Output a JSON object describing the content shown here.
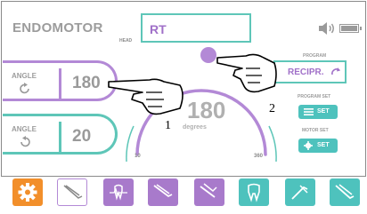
{
  "header": {
    "app_title": "ENDOMOTOR",
    "head_label": "HEAD",
    "head_value": "RT"
  },
  "angles": {
    "forward": {
      "label": "ANGLE",
      "value": "180"
    },
    "reverse": {
      "label": "ANGLE",
      "value": "20"
    }
  },
  "dial": {
    "value": "180",
    "unit": "degrees",
    "min": "10",
    "max": "360"
  },
  "program": {
    "label": "PROGRAM",
    "value": "RECIPR.",
    "program_set_label": "PROGRAM SET",
    "motor_set_label": "MOTOR SET",
    "set_label": "SET"
  },
  "callouts": {
    "one": "1",
    "two": "2"
  },
  "toolbar": {
    "items": [
      {
        "name": "settings",
        "icon": "gear-icon",
        "color": "#f28f2b"
      },
      {
        "name": "tool-1",
        "icon": "handpiece-icon",
        "color": "#ffffff"
      },
      {
        "name": "tool-2",
        "icon": "tooth-scan-icon",
        "color": "#a87acb"
      },
      {
        "name": "tool-3",
        "icon": "handpiece-icon",
        "color": "#a87acb"
      },
      {
        "name": "tool-4",
        "icon": "handpiece-icon",
        "color": "#a87acb"
      },
      {
        "name": "tool-5",
        "icon": "tooth-icon",
        "color": "#4ec2bd"
      },
      {
        "name": "tool-6",
        "icon": "handpiece-icon",
        "color": "#4ec2bd"
      },
      {
        "name": "tool-7",
        "icon": "handpiece-icon",
        "color": "#4ec2bd"
      }
    ]
  },
  "colors": {
    "purple": "#b389d6",
    "teal": "#5ec6b8",
    "orange": "#f28f2b"
  }
}
